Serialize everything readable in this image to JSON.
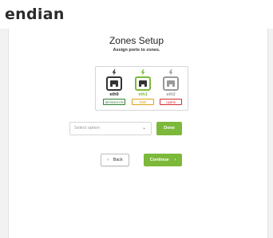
{
  "brand": {
    "logo_text": "endian"
  },
  "page": {
    "title": "Zones Setup",
    "subtitle": "Assign ports to zones."
  },
  "ports": [
    {
      "name": "eth0",
      "zone": "Service/LAN",
      "color": "#333333",
      "icon_color": "#333333",
      "tag_color": "#2e7d32",
      "bolt_color": "#333333",
      "selected": false
    },
    {
      "name": "eth1",
      "zone": "DMZ",
      "color": "#7cb83a",
      "icon_color": "#333333",
      "tag_color": "#e0a21b",
      "bolt_color": "#7cb83a",
      "selected": true
    },
    {
      "name": "eth2",
      "zone": "Uplink",
      "color": "#999999",
      "icon_color": "#999999",
      "tag_color": "#d32f2f",
      "bolt_color": "#999999",
      "selected": false
    }
  ],
  "zone_select": {
    "placeholder": "Select option"
  },
  "buttons": {
    "done": "Done",
    "back": "Back",
    "back_icon": "chevron-left-icon",
    "continue": "Continue",
    "continue_icon": "chevron-right-icon"
  },
  "colors": {
    "accent": "#7cb83a",
    "background": "#f2f2f2"
  }
}
